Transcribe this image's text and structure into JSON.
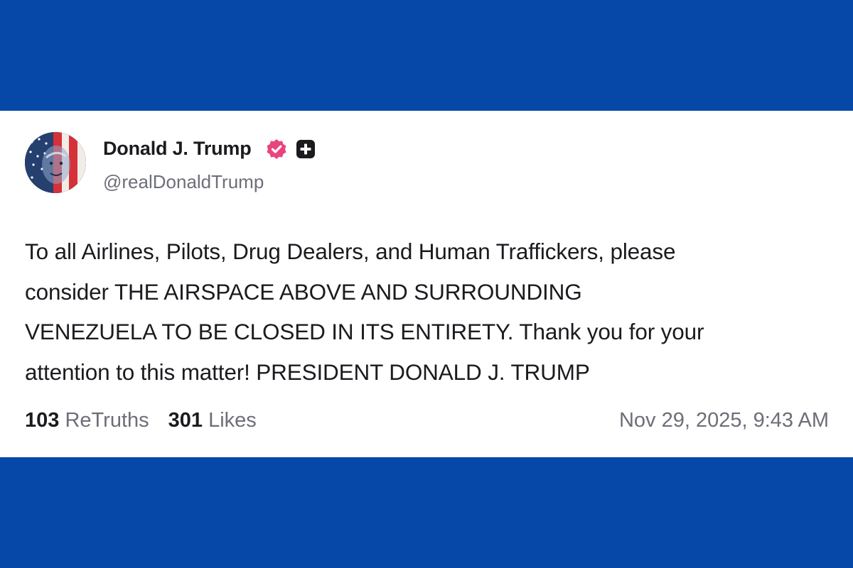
{
  "colors": {
    "background_band": "#0648a8",
    "card": "#ffffff",
    "text_primary": "#1b1b1f",
    "text_secondary": "#6d6e78",
    "verified_badge": "#e9447f",
    "plus_badge": "#1b1b1f"
  },
  "author": {
    "display_name": "Donald J. Trump",
    "handle": "@realDonaldTrump",
    "avatar_icon": "american-flag-portrait-avatar",
    "badges": [
      "verified-icon",
      "plus-badge-icon"
    ]
  },
  "post": {
    "lines": [
      "To all Airlines, Pilots, Drug Dealers, and Human Traffickers, please",
      "consider THE AIRSPACE ABOVE AND SURROUNDING",
      "VENEZUELA TO BE CLOSED IN ITS ENTIRETY. Thank you for your",
      "attention to this matter! PRESIDENT DONALD J. TRUMP"
    ]
  },
  "stats": {
    "retruths_count": "103",
    "retruths_label": "ReTruths",
    "likes_count": "301",
    "likes_label": "Likes"
  },
  "timestamp": "Nov 29, 2025, 9:43 AM"
}
